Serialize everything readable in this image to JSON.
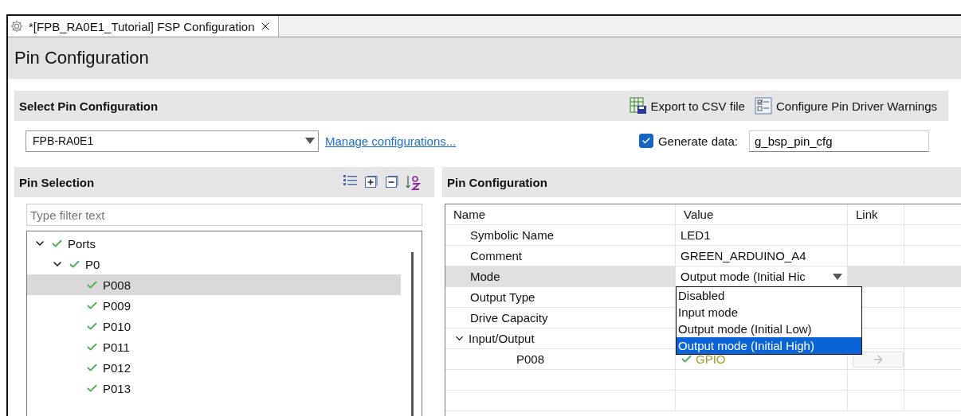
{
  "tab": {
    "title": "*[FPB_RA0E1_Tutorial] FSP Configuration"
  },
  "page_title": "Pin Configuration",
  "select_section": {
    "title": "Select Pin Configuration",
    "actions": [
      {
        "kind": "export",
        "label": "Export to CSV file"
      },
      {
        "kind": "warnings",
        "label": "Configure Pin Driver Warnings"
      }
    ],
    "configuration": {
      "value": "FPB-RA0E1"
    },
    "manage_link": "Manage configurations...",
    "generate": {
      "label": "Generate data:",
      "checked": true,
      "value": "g_bsp_pin_cfg"
    }
  },
  "pin_selection": {
    "title": "Pin Selection",
    "filter": {
      "placeholder": "Type filter text"
    },
    "tree": [
      {
        "label": "Ports",
        "ok": true,
        "expanded": true,
        "selected": false,
        "children": [
          {
            "label": "P0",
            "ok": true,
            "expanded": true,
            "selected": false,
            "children": [
              {
                "label": "P008",
                "ok": true,
                "selected": true
              },
              {
                "label": "P009",
                "ok": true,
                "selected": false
              },
              {
                "label": "P010",
                "ok": true,
                "selected": false
              },
              {
                "label": "P011",
                "ok": true,
                "selected": false
              },
              {
                "label": "P012",
                "ok": true,
                "selected": false
              },
              {
                "label": "P013",
                "ok": true,
                "selected": false
              }
            ]
          }
        ]
      }
    ]
  },
  "pin_configuration": {
    "title": "Pin Configuration",
    "columns": [
      "Name",
      "Value",
      "Link"
    ],
    "rows": [
      {
        "name": "Symbolic Name",
        "value": "LED1",
        "selected": false
      },
      {
        "name": "Comment",
        "value": "GREEN_ARDUINO_A4",
        "selected": false
      },
      {
        "name": "Mode",
        "value": "Output mode (Initial Hic",
        "selected": true,
        "kind": "combo"
      },
      {
        "name": "Output Type",
        "selected": false
      },
      {
        "name": "Drive Capacity",
        "selected": false
      },
      {
        "name": "Input/Output",
        "selected": false,
        "expanded": true,
        "children": [
          {
            "name": "P008",
            "value": "GPIO",
            "ok": true,
            "selected": false,
            "link": true
          }
        ]
      }
    ],
    "dropdown": {
      "options": [
        {
          "label": "Disabled",
          "selected": false
        },
        {
          "label": "Input mode",
          "selected": false
        },
        {
          "label": "Output mode (Initial Low)",
          "selected": false
        },
        {
          "label": "Output mode (Initial High)",
          "selected": true
        }
      ]
    }
  }
}
